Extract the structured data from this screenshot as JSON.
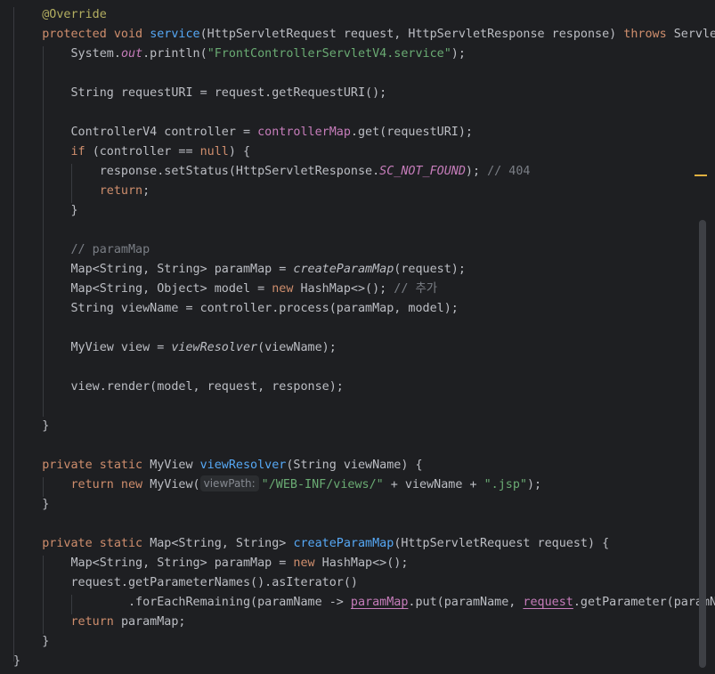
{
  "editor": {
    "lines": [
      {
        "indent": "    ",
        "tokens": [
          {
            "t": "@Override",
            "c": "ann"
          }
        ]
      },
      {
        "indent": "    ",
        "tokens": [
          {
            "t": "protected void ",
            "c": "kw"
          },
          {
            "t": "service",
            "c": "fn"
          },
          {
            "t": "(HttpServletRequest request, HttpServletResponse response) "
          },
          {
            "t": "throws ",
            "c": "kw"
          },
          {
            "t": "ServletException, IOException {"
          }
        ]
      },
      {
        "indent": "        ",
        "tokens": [
          {
            "t": "System."
          },
          {
            "t": "out",
            "c": "sfield"
          },
          {
            "t": ".println("
          },
          {
            "t": "\"FrontControllerServletV4.service\"",
            "c": "str"
          },
          {
            "t": ");"
          }
        ]
      },
      {
        "indent": "",
        "tokens": []
      },
      {
        "indent": "        ",
        "tokens": [
          {
            "t": "String requestURI = request.getRequestURI();"
          }
        ]
      },
      {
        "indent": "",
        "tokens": []
      },
      {
        "indent": "        ",
        "tokens": [
          {
            "t": "ControllerV4 controller = "
          },
          {
            "t": "controllerMap",
            "c": "fld"
          },
          {
            "t": ".get(requestURI);"
          }
        ]
      },
      {
        "indent": "        ",
        "tokens": [
          {
            "t": "if ",
            "c": "kw"
          },
          {
            "t": "(controller == "
          },
          {
            "t": "null",
            "c": "kw"
          },
          {
            "t": ") {"
          }
        ]
      },
      {
        "indent": "            ",
        "tokens": [
          {
            "t": "response.setStatus(HttpServletResponse."
          },
          {
            "t": "SC_NOT_FOUND",
            "c": "sfield"
          },
          {
            "t": "); "
          },
          {
            "t": "// 404",
            "c": "cmt"
          }
        ]
      },
      {
        "indent": "            ",
        "tokens": [
          {
            "t": "return",
            "c": "kw"
          },
          {
            "t": ";"
          }
        ]
      },
      {
        "indent": "        ",
        "tokens": [
          {
            "t": "}"
          }
        ]
      },
      {
        "indent": "",
        "tokens": []
      },
      {
        "indent": "        ",
        "tokens": [
          {
            "t": "// paramMap",
            "c": "cmt"
          }
        ]
      },
      {
        "indent": "        ",
        "tokens": [
          {
            "t": "Map<String, String> paramMap = "
          },
          {
            "t": "createParamMap",
            "c": "ital"
          },
          {
            "t": "(request);"
          }
        ]
      },
      {
        "indent": "        ",
        "tokens": [
          {
            "t": "Map<String, Object> model = "
          },
          {
            "t": "new ",
            "c": "kw"
          },
          {
            "t": "HashMap<>(); "
          },
          {
            "t": "// 추가",
            "c": "cmt"
          }
        ]
      },
      {
        "indent": "        ",
        "tokens": [
          {
            "t": "String viewName = controller.process(paramMap, model);"
          }
        ]
      },
      {
        "indent": "",
        "tokens": []
      },
      {
        "indent": "        ",
        "tokens": [
          {
            "t": "MyView view = "
          },
          {
            "t": "viewResolver",
            "c": "ital"
          },
          {
            "t": "(viewName);"
          }
        ]
      },
      {
        "indent": "",
        "tokens": []
      },
      {
        "indent": "        ",
        "tokens": [
          {
            "t": "view.render(model, request, response);"
          }
        ]
      },
      {
        "indent": "",
        "tokens": []
      },
      {
        "indent": "    ",
        "tokens": [
          {
            "t": "}"
          }
        ]
      },
      {
        "indent": "",
        "tokens": []
      },
      {
        "indent": "    ",
        "tokens": [
          {
            "t": "private static ",
            "c": "kw"
          },
          {
            "t": "MyView "
          },
          {
            "t": "viewResolver",
            "c": "fn"
          },
          {
            "t": "(String viewName) {"
          }
        ]
      },
      {
        "indent": "        ",
        "tokens": [
          {
            "t": "return new ",
            "c": "kw"
          },
          {
            "t": "MyView("
          },
          {
            "t": "viewPath:",
            "c": "hint"
          },
          {
            "t": "\"/WEB-INF/views/\"",
            "c": "str"
          },
          {
            "t": " + viewName + "
          },
          {
            "t": "\".jsp\"",
            "c": "str"
          },
          {
            "t": ");"
          }
        ]
      },
      {
        "indent": "    ",
        "tokens": [
          {
            "t": "}"
          }
        ]
      },
      {
        "indent": "",
        "tokens": []
      },
      {
        "indent": "    ",
        "tokens": [
          {
            "t": "private static ",
            "c": "kw"
          },
          {
            "t": "Map<String, String> "
          },
          {
            "t": "createParamMap",
            "c": "fn"
          },
          {
            "t": "(HttpServletRequest request) {"
          }
        ]
      },
      {
        "indent": "        ",
        "tokens": [
          {
            "t": "Map<String, String> paramMap = "
          },
          {
            "t": "new ",
            "c": "kw"
          },
          {
            "t": "HashMap<>();"
          }
        ]
      },
      {
        "indent": "        ",
        "tokens": [
          {
            "t": "request.getParameterNames().asIterator()"
          }
        ]
      },
      {
        "indent": "                ",
        "tokens": [
          {
            "t": ".forEachRemaining(paramName -> "
          },
          {
            "t": "paramMap",
            "c": "fldu"
          },
          {
            "t": ".put(paramName, "
          },
          {
            "t": "request",
            "c": "fldu"
          },
          {
            "t": ".getParameter(paramName)));"
          }
        ]
      },
      {
        "indent": "        ",
        "tokens": [
          {
            "t": "return ",
            "c": "kw"
          },
          {
            "t": "paramMap;"
          }
        ]
      },
      {
        "indent": "    ",
        "tokens": [
          {
            "t": "}"
          }
        ]
      },
      {
        "indent": "",
        "tokens": [
          {
            "t": "}"
          }
        ]
      }
    ]
  }
}
